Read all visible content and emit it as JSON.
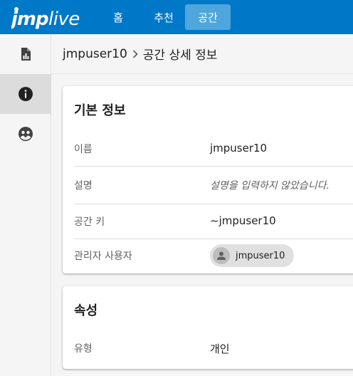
{
  "app": {
    "logo_text": "jmplive"
  },
  "nav": [
    {
      "label": "홈"
    },
    {
      "label": "추천"
    },
    {
      "label": "공간",
      "active": true
    }
  ],
  "sidebar": {
    "items": [
      {
        "icon": "report-icon"
      },
      {
        "icon": "info-icon",
        "active": true
      },
      {
        "icon": "people-icon"
      }
    ]
  },
  "breadcrumb": {
    "parent": "jmpuser10",
    "current": "공간 상세 정보"
  },
  "basic_info": {
    "title": "기본 정보",
    "rows": [
      {
        "label": "이름",
        "value": "jmpuser10"
      },
      {
        "label": "설명",
        "value": "설명을 입력하지 않았습니다."
      },
      {
        "label": "공간 키",
        "value": "~jmpuser10"
      },
      {
        "label": "관리자 사용자",
        "value": "jmpuser10"
      }
    ]
  },
  "attributes": {
    "title": "속성",
    "rows": [
      {
        "label": "유형",
        "value": "개인"
      }
    ]
  },
  "colors": {
    "topbar": "#0078c8",
    "active_tab": "#4ea6dc",
    "sidebar_active": "#dcdcdc"
  }
}
